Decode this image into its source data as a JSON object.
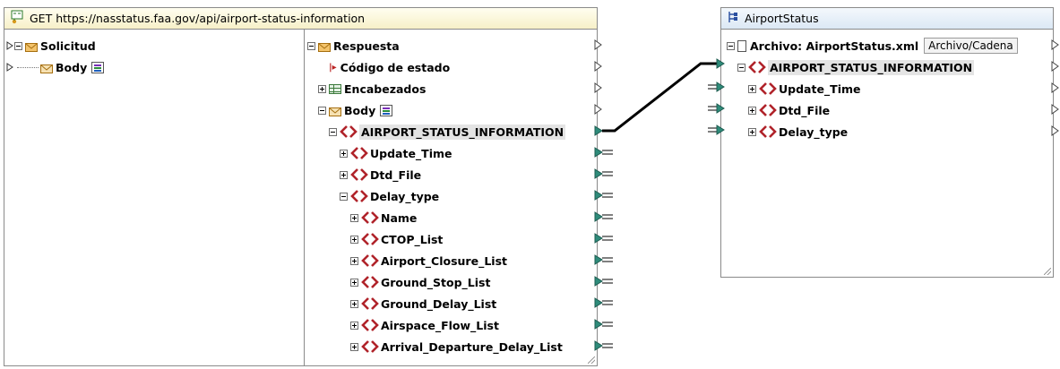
{
  "rest_component": {
    "title": "GET https://nasstatus.faa.gov/api/airport-status-information",
    "request_tree": {
      "root": "Solicitud",
      "body": "Body"
    },
    "response_tree": {
      "root": "Respuesta",
      "status_code": "Código de estado",
      "headers": "Encabezados",
      "body": "Body",
      "element": "AIRPORT_STATUS_INFORMATION",
      "children": [
        "Update_Time",
        "Dtd_File",
        "Delay_type"
      ],
      "delay_children": [
        "Name",
        "CTOP_List",
        "Airport_Closure_List",
        "Ground_Stop_List",
        "Ground_Delay_List",
        "Airspace_Flow_List",
        "Arrival_Departure_Delay_List"
      ]
    }
  },
  "target_component": {
    "title": "AirportStatus",
    "file_label": "Archivo: AirportStatus.xml",
    "file_button": "Archivo/Cadena",
    "element": "AIRPORT_STATUS_INFORMATION",
    "children": [
      "Update_Time",
      "Dtd_File",
      "Delay_type"
    ]
  },
  "colors": {
    "element_icon": "#b0232a",
    "port_filled": "#2e8b7a",
    "rest_title_bg": "#f7f0c8",
    "target_title_bg": "#dbe8f5"
  }
}
